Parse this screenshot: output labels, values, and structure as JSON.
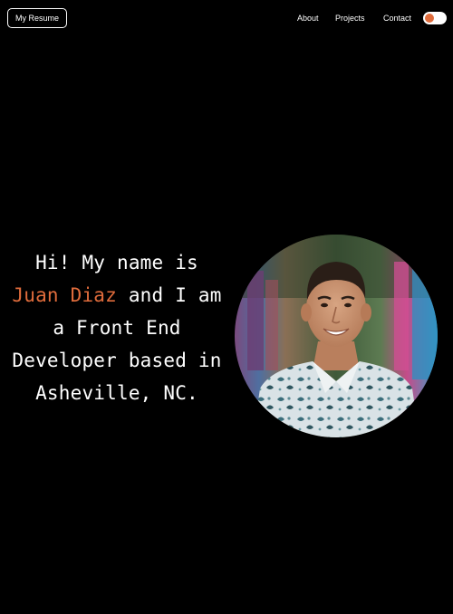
{
  "header": {
    "resume_label": "My Resume",
    "nav": [
      {
        "label": "About"
      },
      {
        "label": "Projects"
      },
      {
        "label": "Contact"
      }
    ],
    "theme_toggle": {
      "on": true,
      "knob_color": "#e06c3c"
    }
  },
  "hero": {
    "line1": "Hi! My name is",
    "name": "Juan Diaz",
    "line2_rest": " and I am",
    "line3": "a Front End",
    "line4": "Developer based in",
    "line5": "Asheville, NC.",
    "accent_color": "#e06c3c"
  },
  "profile_photo": {
    "icon": "profile-photo"
  }
}
